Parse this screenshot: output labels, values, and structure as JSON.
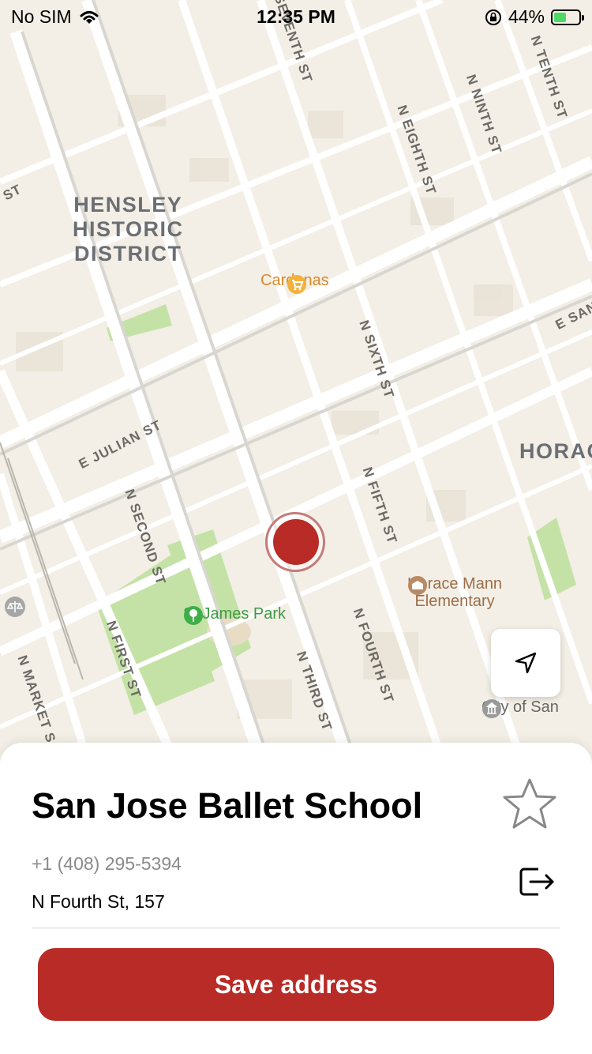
{
  "status_bar": {
    "carrier": "No SIM",
    "time": "12:35 PM",
    "battery_percent": "44%",
    "battery_level": 0.44
  },
  "map": {
    "district_label": [
      "HENSLEY",
      "HISTORIC",
      "DISTRICT"
    ],
    "district_label_right": "HORAC",
    "streets": {
      "seventh": "N SEVENTH ST",
      "eighth": "N EIGHTH ST",
      "ninth": "N NINTH ST",
      "tenth": "N TENTH ST",
      "sixth": "N SIXTH ST",
      "fifth": "N FIFTH ST",
      "fourth": "N FOURTH ST",
      "third": "N THIRD ST",
      "second": "N SECOND ST",
      "first": "N FIRST ST",
      "market": "N MARKET S",
      "julian": "E JULIAN ST",
      "st_left": "ST",
      "san": "E SAN"
    },
    "pois": {
      "cardenas": "Cardenas",
      "park": "St James Park",
      "school": [
        "Horace Mann",
        "Elementary"
      ],
      "city": "City of San"
    },
    "icons": [
      "wifi-icon",
      "lock-rotation-icon",
      "shopping-cart-icon",
      "park-icon",
      "school-icon",
      "courthouse-icon",
      "city-hall-icon",
      "location-arrow-icon"
    ]
  },
  "place": {
    "name": "San Jose Ballet School",
    "phone": "+1 (408) 295-5394",
    "address": "N Fourth St, 157"
  },
  "actions": {
    "save_label": "Save address"
  },
  "colors": {
    "accent": "#b82b26",
    "map_background": "#f3efe6",
    "park": "#c4e2a6"
  }
}
